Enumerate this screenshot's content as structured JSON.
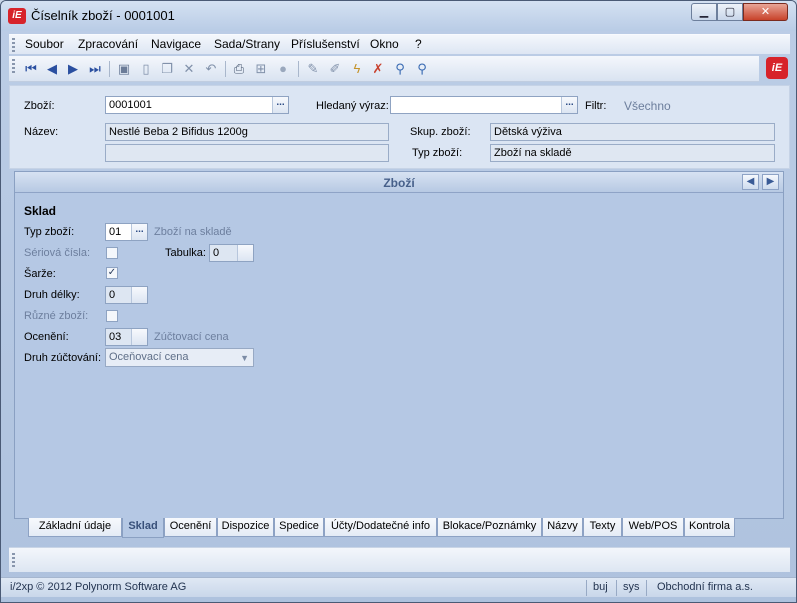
{
  "window": {
    "title": "Číselník zboží - 0001001",
    "logo_text": "iE"
  },
  "menu": [
    "Soubor",
    "Zpracování",
    "Navigace",
    "Sada/Strany",
    "Příslušenství",
    "Okno",
    "?"
  ],
  "toolbar": {
    "icons": [
      "first-record-icon",
      "previous-record-icon",
      "next-record-icon",
      "last-record-icon",
      "save-icon",
      "new-icon",
      "copy-icon",
      "delete-icon",
      "undo-icon",
      "print-icon",
      "tree-icon",
      "refresh-icon",
      "edit-icon",
      "edit-alt-icon",
      "filter-icon",
      "clear-filter-icon",
      "search-icon",
      "advanced-search-icon"
    ]
  },
  "header": {
    "item_label": "Zboží:",
    "item_value": "0001001",
    "search_label": "Hledaný výraz:",
    "search_value": "",
    "filter_label": "Filtr:",
    "filter_value": "Všechno",
    "name_label": "Název:",
    "name_value": "Nestlé Beba 2 Bifidus 1200g",
    "name_value_2": "",
    "group_label": "Skup. zboží:",
    "group_value": "Dětská výživa",
    "type_label": "Typ zboží:",
    "type_value": "Zboží na skladě",
    "dots": "..."
  },
  "panel": {
    "title": "Zboží",
    "section": "Sklad",
    "fields": {
      "typ_label": "Typ zboží:",
      "typ_value": "01",
      "typ_hint": "Zboží na skladě",
      "serial_label": "Sériová čísla:",
      "table_label": "Tabulka:",
      "table_value": "0",
      "batch_label": "Šarže:",
      "batch_checked": "✓",
      "length_label": "Druh délky:",
      "length_value": "0",
      "various_label": "Různé zboží:",
      "valuation_label": "Ocenění:",
      "valuation_value": "03",
      "valuation_hint": "Zúčtovací cena",
      "accounting_label": "Druh zúčtování:",
      "accounting_value": "Oceňovací cena"
    }
  },
  "tabs": [
    "Základní údaje",
    "Sklad",
    "Ocenění",
    "Dispozice",
    "Spedice",
    "Účty/Dodatečné info",
    "Blokace/Poznámky",
    "Názvy",
    "Texty",
    "Web/POS",
    "Kontrola"
  ],
  "active_tab": "Sklad",
  "status": {
    "copyright": "i/2xp © 2012 Polynorm Software AG",
    "user": "buj",
    "system": "sys",
    "company": "Obchodní firma a.s."
  }
}
